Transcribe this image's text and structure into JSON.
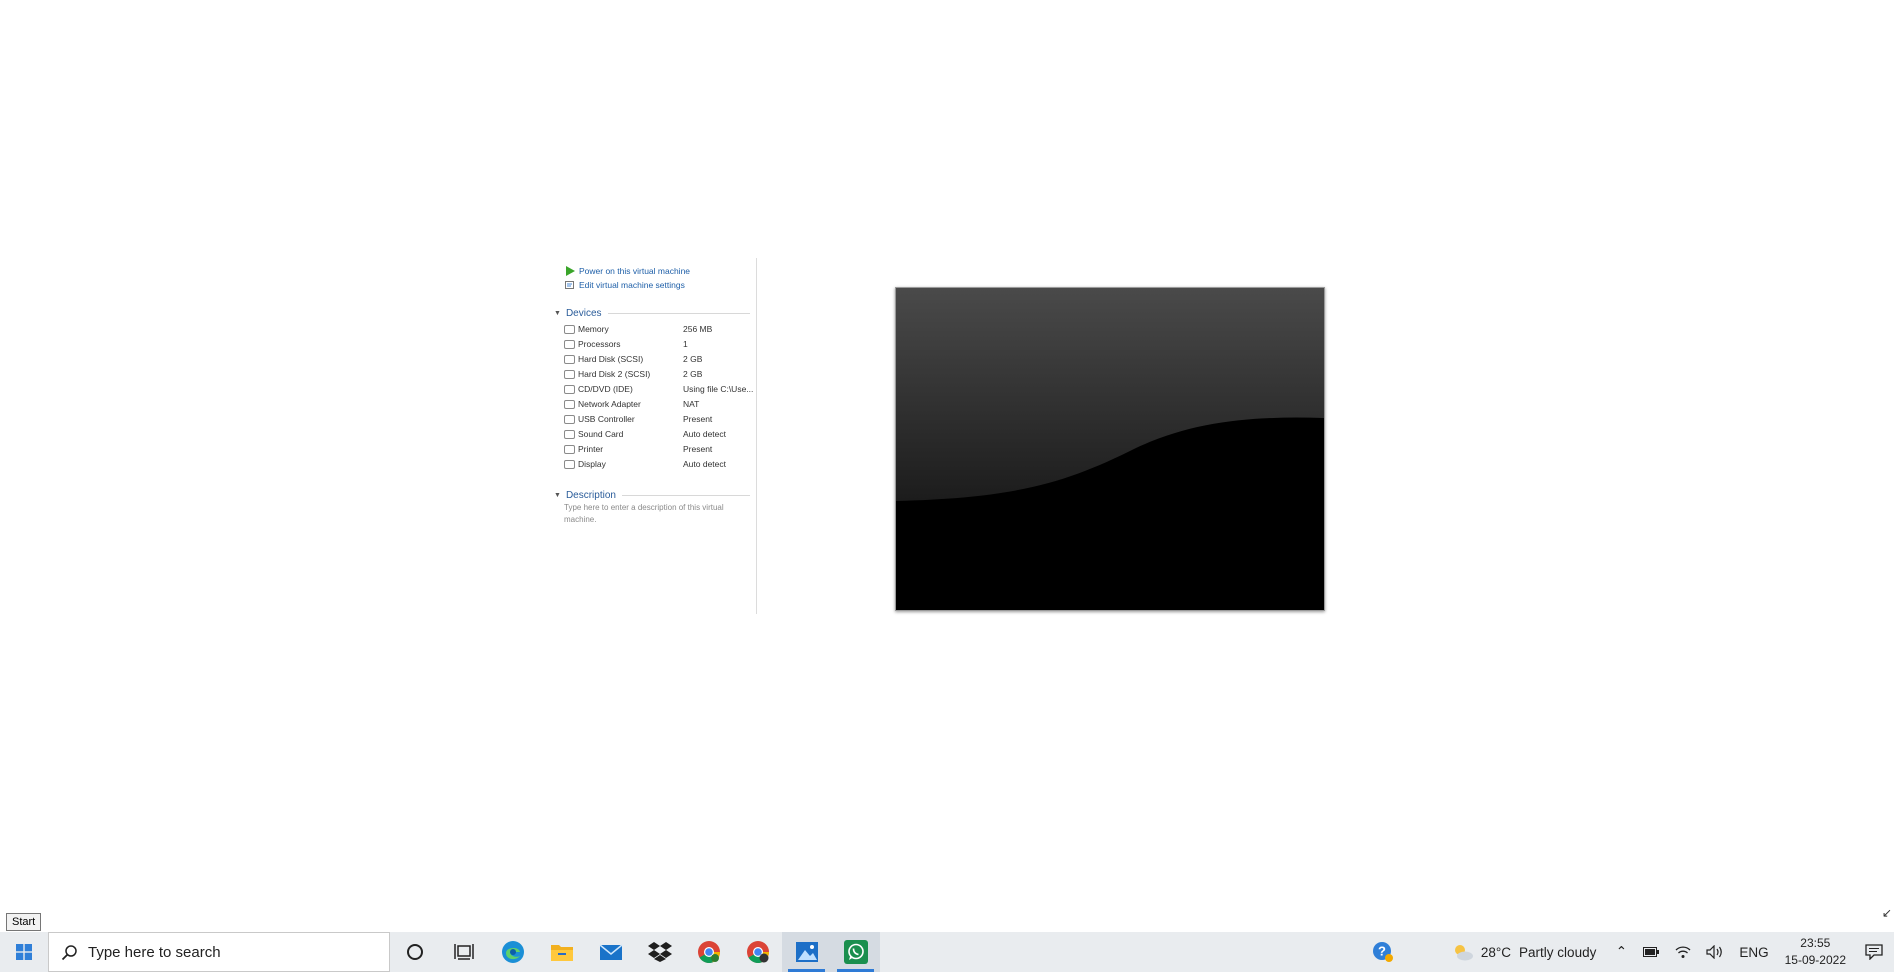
{
  "vm_panel": {
    "commands": {
      "power_on": "Power on this virtual machine",
      "edit_settings": "Edit virtual machine settings"
    },
    "devices_heading": "Devices",
    "devices": [
      {
        "name": "Memory",
        "value": "256 MB",
        "icon": "memory-icon"
      },
      {
        "name": "Processors",
        "value": "1",
        "icon": "processor-icon"
      },
      {
        "name": "Hard Disk (SCSI)",
        "value": "2 GB",
        "icon": "hard-disk-icon"
      },
      {
        "name": "Hard Disk 2 (SCSI)",
        "value": "2 GB",
        "icon": "hard-disk-icon"
      },
      {
        "name": "CD/DVD (IDE)",
        "value": "Using file C:\\Use...",
        "icon": "cd-dvd-icon"
      },
      {
        "name": "Network Adapter",
        "value": "NAT",
        "icon": "network-adapter-icon"
      },
      {
        "name": "USB Controller",
        "value": "Present",
        "icon": "usb-icon"
      },
      {
        "name": "Sound Card",
        "value": "Auto detect",
        "icon": "speaker-icon"
      },
      {
        "name": "Printer",
        "value": "Present",
        "icon": "printer-icon"
      },
      {
        "name": "Display",
        "value": "Auto detect",
        "icon": "monitor-icon"
      }
    ],
    "description_heading": "Description",
    "description_placeholder": "Type here to enter a description of this virtual machine."
  },
  "tooltip": {
    "start": "Start"
  },
  "taskbar": {
    "search_placeholder": "Type here to search",
    "apps": [
      "cortana-icon",
      "task-view-icon",
      "edge-icon",
      "file-explorer-icon",
      "mail-icon",
      "dropbox-icon",
      "chrome-icon",
      "chrome-profile-icon",
      "photos-icon",
      "whatsapp-icon"
    ],
    "weather": {
      "temp": "28°C",
      "condition": "Partly cloudy"
    },
    "language": "ENG",
    "time": "23:55",
    "date": "15-09-2022"
  },
  "colors": {
    "link": "#1e5fa8",
    "heading": "#2a5c9a",
    "taskbar": "#e9ecef",
    "accent": "#2e7bd6"
  }
}
